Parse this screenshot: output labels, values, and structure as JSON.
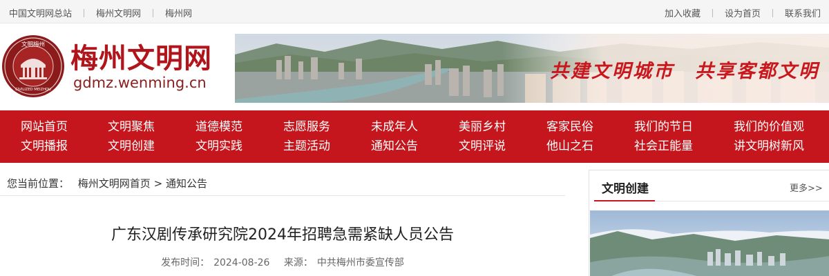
{
  "topbar": {
    "left_links": [
      "中国文明网总站",
      "梅州文明网",
      "梅州网"
    ],
    "right_links": [
      "加入收藏",
      "设为首页",
      "联系我们"
    ]
  },
  "header": {
    "site_name": "梅州文明网",
    "domain": "gdmz.wenming.cn",
    "emblem_top_text": "文明梅州",
    "emblem_bottom_text": "CIVILIZED MEIZHOU",
    "slogan_1": "共建文明城市",
    "slogan_2": "共享客都文明"
  },
  "nav": {
    "row1": [
      "网站首页",
      "文明聚焦",
      "道德模范",
      "志愿服务",
      "未成年人",
      "美丽乡村",
      "客家民俗",
      "我们的节日",
      "我们的价值观"
    ],
    "row2": [
      "文明播报",
      "文明创建",
      "文明实践",
      "主题活动",
      "通知公告",
      "文明评说",
      "他山之石",
      "社会正能量",
      "讲文明树新风"
    ]
  },
  "breadcrumb": {
    "prefix": "您当前位置：",
    "home": "梅州文明网首页",
    "separator": ">",
    "current": "通知公告"
  },
  "article": {
    "title": "广东汉剧传承研究院2024年招聘急需紧缺人员公告",
    "date_label": "发布时间：",
    "date": "2024-08-26",
    "source_label": "来源：",
    "source": "中共梅州市委宣传部"
  },
  "sidebar": {
    "title": "文明创建",
    "more": "更多>>"
  },
  "colors": {
    "brand_red": "#c4161c",
    "logo_red": "#b0151b"
  }
}
